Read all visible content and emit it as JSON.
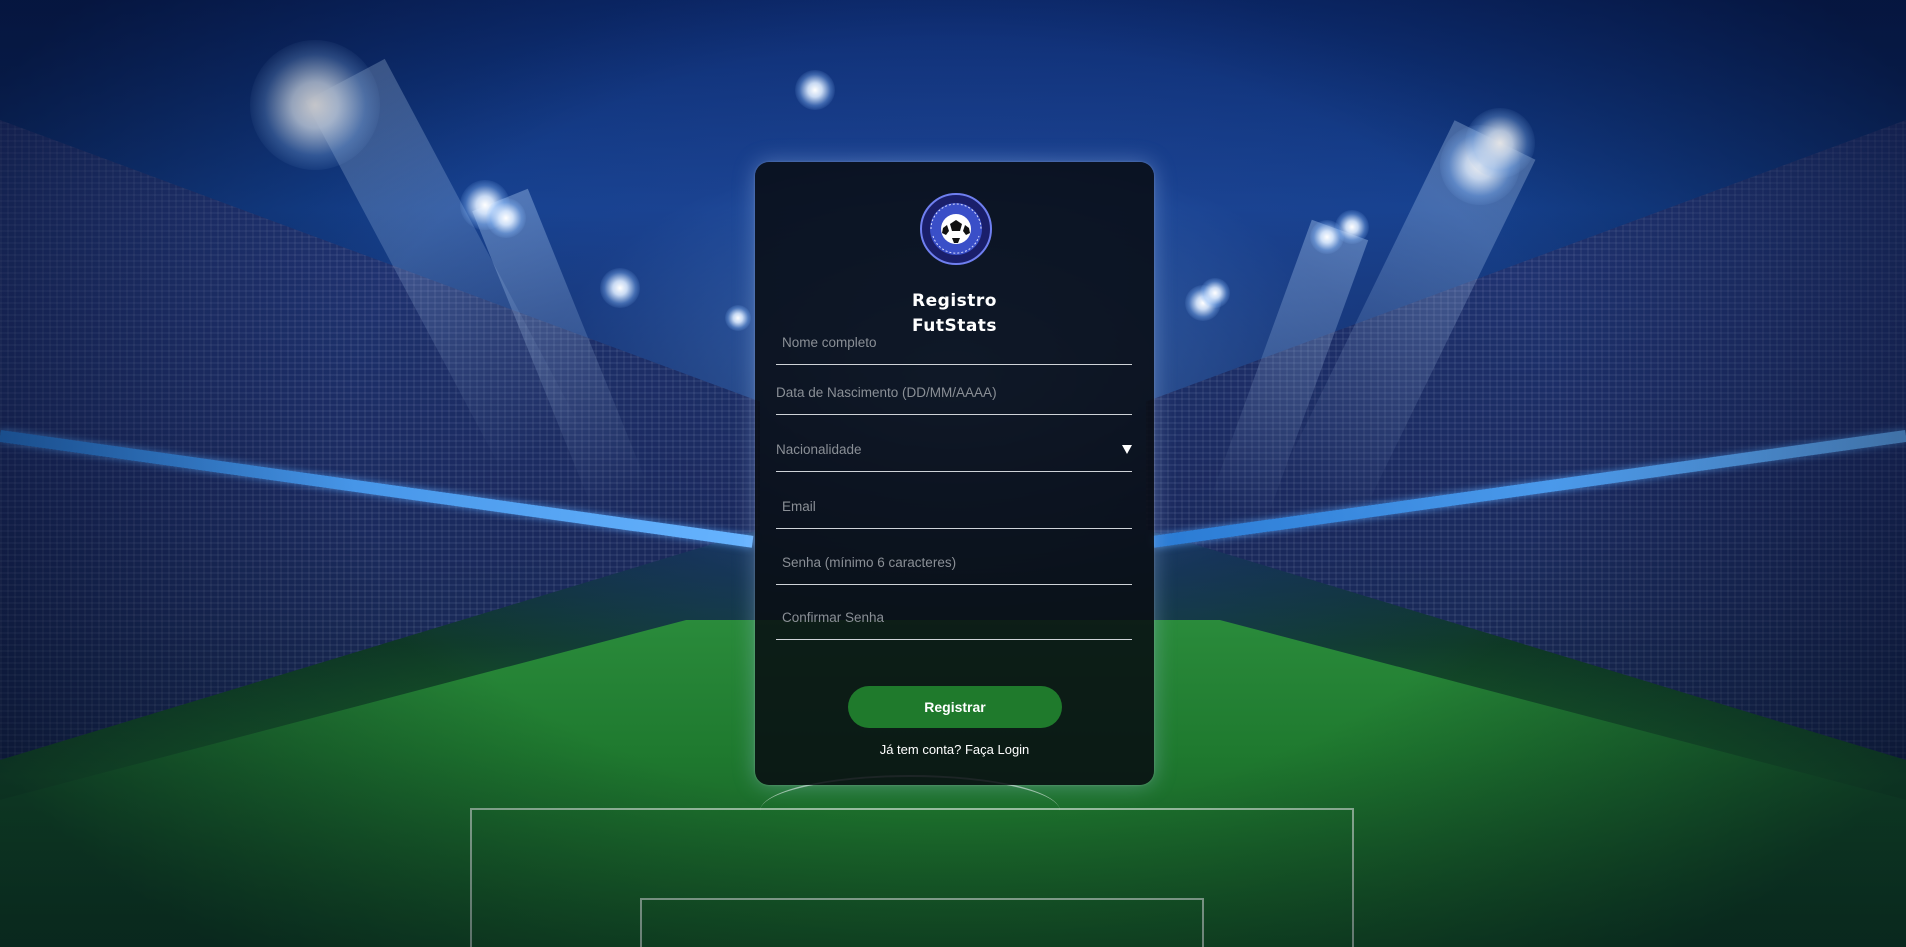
{
  "form": {
    "title_line1": "Registro",
    "title_line2": "FutStats",
    "logo_icon": "football-news-and-stats-logo",
    "fields": {
      "full_name_placeholder": "Nome completo",
      "birthdate_placeholder": "Data de Nascimento (DD/MM/AAAA)",
      "nationality_placeholder": "Nacionalidade",
      "email_placeholder": "Email",
      "password_placeholder": "Senha (mínimo 6 caracteres)",
      "confirm_password_placeholder": "Confirmar Senha"
    },
    "submit_label": "Registrar",
    "login_link": "Já tem conta? Faça Login"
  },
  "colors": {
    "card_bg": "#080c12",
    "button_green": "#1f7a2c",
    "placeholder": "#8a8f96",
    "underline": "#cfd3d8",
    "logo_blue": "#3a4fc8"
  }
}
